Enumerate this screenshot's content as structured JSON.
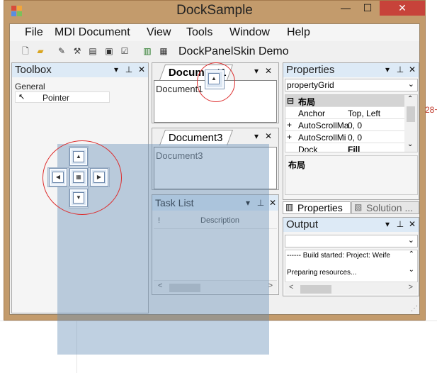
{
  "window": {
    "title": "DockSample",
    "min_glyph": "—",
    "max_glyph": "☐",
    "close_glyph": "✕"
  },
  "menu": [
    "File",
    "MDI Document",
    "View",
    "Tools",
    "Window",
    "Help"
  ],
  "toolbar": {
    "icons": [
      "new-file-icon",
      "open-folder-icon",
      "toolbar-icon-3",
      "tools-icon",
      "list-icon",
      "checklist-icon",
      "tool-icon-7",
      "tool-icon-8"
    ],
    "label": "DockPanelSkin Demo"
  },
  "toolbox": {
    "title": "Toolbox",
    "group": "General",
    "item": "Pointer"
  },
  "document1": {
    "tab": "Document1",
    "content": "Document1"
  },
  "document3": {
    "tab": "Document3",
    "content": "Document3"
  },
  "task_list": {
    "title": "Task List",
    "col_icon": "!",
    "col_description": "Description"
  },
  "properties": {
    "title": "Properties",
    "selector": "propertyGrid",
    "category": "布局",
    "rows": [
      {
        "expander": "",
        "name": "Anchor",
        "value": "Top, Left"
      },
      {
        "expander": "+",
        "name": "AutoScrollMa",
        "value": "0, 0"
      },
      {
        "expander": "+",
        "name": "AutoScrollMi",
        "value": "0, 0"
      },
      {
        "expander": "",
        "name": "Dock",
        "value": "Fill"
      }
    ],
    "description": "布局",
    "tab_properties": "Properties",
    "tab_solution": "Solution ..."
  },
  "output": {
    "title": "Output",
    "line1": "------ Build started: Project: Weife",
    "line2": "Preparing resources..."
  },
  "side_text": "28~",
  "colors": {
    "title_bar": "#c39b6c",
    "close_button": "#c7433a",
    "panel_header": "#ddeaf6",
    "dock_preview": "#678eb8"
  }
}
